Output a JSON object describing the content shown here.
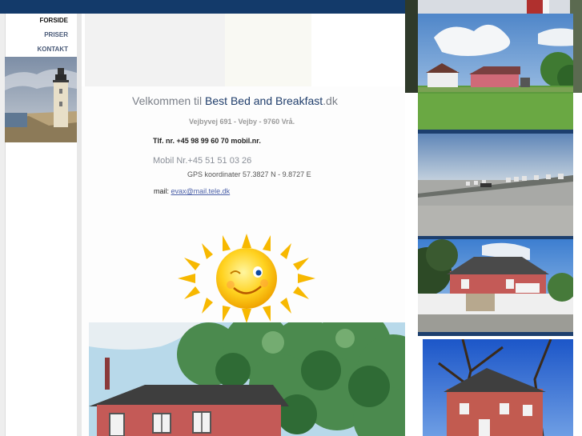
{
  "nav": {
    "items": [
      {
        "label": "FORSIDE",
        "active": true
      },
      {
        "label": "PRISER",
        "active": false
      },
      {
        "label": "KONTAKT",
        "active": false
      }
    ]
  },
  "main": {
    "welcome_prefix": "Velkommen til ",
    "welcome_brand": "Best Bed and Breakfast",
    "welcome_suffix": ".dk",
    "address": "Vejbyvej 691 - Vejby - 9760 Vrå.",
    "phone": "Tlf. nr. +45 98 99 60 70 mobil.nr.",
    "mobile": "Mobil Nr.+45 51 51 03 26",
    "gps": "GPS  koordinater 57.3827 N - 9.8727 E",
    "mail_label": "mail: ",
    "mail_address": "evax@mail.tele.dk"
  },
  "colors": {
    "topbar": "#133a6a",
    "brand_text": "#1f3d6b",
    "link": "#4a5fa8"
  }
}
